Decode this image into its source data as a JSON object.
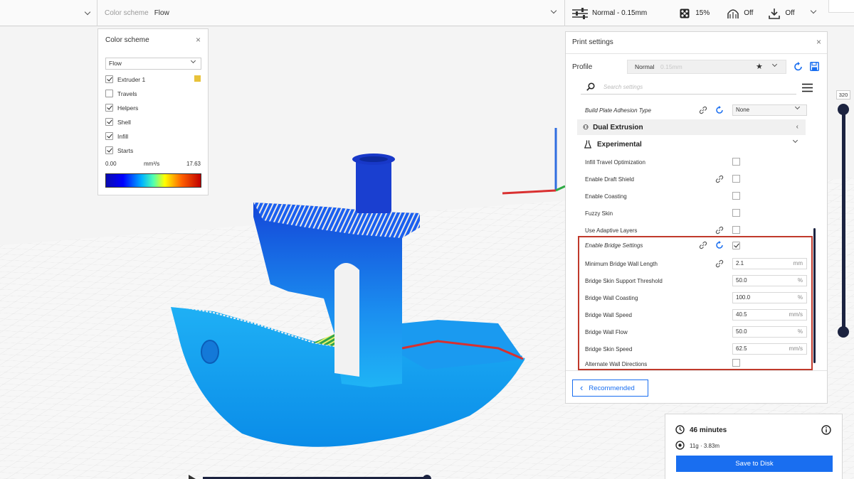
{
  "topbar": {
    "color_scheme_label": "Color scheme",
    "color_scheme_value": "Flow",
    "profile_summary": "Normal - 0.15mm",
    "infill": "15%",
    "support": "Off",
    "adhesion": "Off"
  },
  "color_scheme_panel": {
    "title": "Color scheme",
    "dropdown_value": "Flow",
    "items": [
      {
        "label": "Extruder 1",
        "checked": true
      },
      {
        "label": "Travels",
        "checked": false
      },
      {
        "label": "Helpers",
        "checked": true
      },
      {
        "label": "Shell",
        "checked": true
      },
      {
        "label": "Infill",
        "checked": true
      },
      {
        "label": "Starts",
        "checked": true
      }
    ],
    "extruder_color": "#e8c23a",
    "range_min": "0.00",
    "range_unit": "mm³/s",
    "range_max": "17.63"
  },
  "print_settings": {
    "title": "Print settings",
    "profile_label": "Profile",
    "profile_name": "Normal",
    "profile_suffix": "0.15mm",
    "search_placeholder": "Search settings",
    "adhesion_row": {
      "label": "Build Plate Adhesion Type",
      "value": "None"
    },
    "sections": [
      {
        "label": "Dual Extrusion"
      },
      {
        "label": "Experimental"
      }
    ],
    "experimental_checkboxes": [
      {
        "label": "Infill Travel Optimization",
        "checked": false
      },
      {
        "label": "Enable Draft Shield",
        "checked": false
      },
      {
        "label": "Enable Coasting",
        "checked": false
      },
      {
        "label": "Fuzzy Skin",
        "checked": false
      },
      {
        "label": "Use Adaptive Layers",
        "checked": false
      }
    ],
    "bridge": {
      "enable_label": "Enable Bridge Settings",
      "enable_checked": true,
      "rows": [
        {
          "label": "Minimum Bridge Wall Length",
          "value": "2.1",
          "unit": "mm"
        },
        {
          "label": "Bridge Skin Support Threshold",
          "value": "50.0",
          "unit": "%"
        },
        {
          "label": "Bridge Wall Coasting",
          "value": "100.0",
          "unit": "%"
        },
        {
          "label": "Bridge Wall Speed",
          "value": "40.5",
          "unit": "mm/s"
        },
        {
          "label": "Bridge Wall Flow",
          "value": "50.0",
          "unit": "%"
        },
        {
          "label": "Bridge Skin Speed",
          "value": "62.5",
          "unit": "mm/s"
        }
      ],
      "alternate_label": "Alternate Wall Directions",
      "alternate_checked": false
    },
    "recommended_label": "Recommended"
  },
  "layer_slider": {
    "max_value": "320"
  },
  "estimate": {
    "time": "46 minutes",
    "material": "11g · 3.83m",
    "save_label": "Save to Disk"
  },
  "colors": {
    "accent": "#196ef0",
    "highlight_border": "#c0392b",
    "slider_dark": "#1c2340"
  }
}
